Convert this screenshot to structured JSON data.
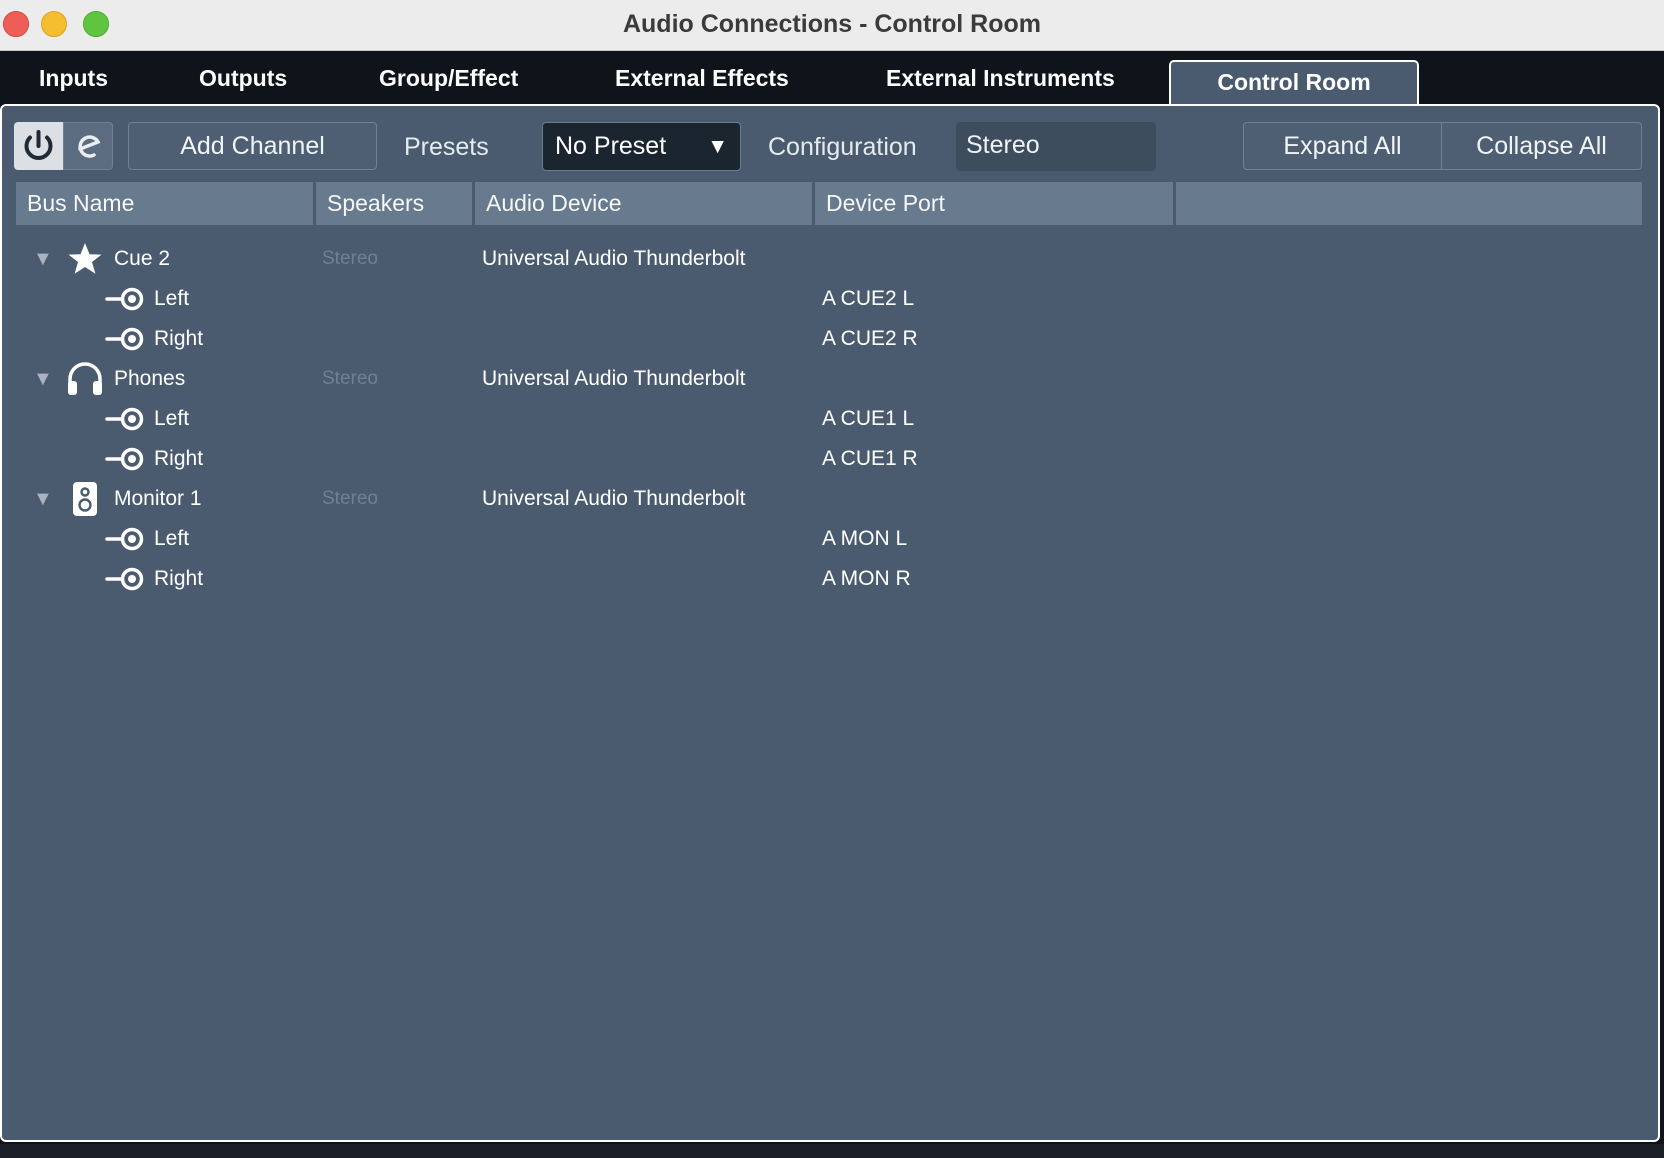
{
  "window": {
    "title": "Audio Connections - Control Room"
  },
  "tabs": [
    {
      "label": "Inputs",
      "active": false
    },
    {
      "label": "Outputs",
      "active": false
    },
    {
      "label": "Group/Effect",
      "active": false
    },
    {
      "label": "External Effects",
      "active": false
    },
    {
      "label": "External Instruments",
      "active": false
    },
    {
      "label": "Control Room",
      "active": true
    }
  ],
  "toolbar": {
    "power_icon": "power-icon",
    "e_icon": "edit-e-icon",
    "add_channel_label": "Add Channel",
    "presets_label": "Presets",
    "preset_value": "No Preset",
    "configuration_label": "Configuration",
    "configuration_value": "Stereo",
    "expand_all_label": "Expand All",
    "collapse_all_label": "Collapse All"
  },
  "table": {
    "columns": [
      "Bus Name",
      "Speakers",
      "Audio Device",
      "Device Port",
      ""
    ],
    "buses": [
      {
        "name": "Cue 2",
        "icon": "star-icon",
        "speakers": "Stereo",
        "device": "Universal Audio Thunderbolt",
        "expanded": true,
        "ports": [
          {
            "name": "Left",
            "port": "A CUE2 L"
          },
          {
            "name": "Right",
            "port": "A CUE2 R"
          }
        ]
      },
      {
        "name": "Phones",
        "icon": "headphones-icon",
        "speakers": "Stereo",
        "device": "Universal Audio Thunderbolt",
        "expanded": true,
        "ports": [
          {
            "name": "Left",
            "port": "A CUE1 L"
          },
          {
            "name": "Right",
            "port": "A CUE1 R"
          }
        ]
      },
      {
        "name": "Monitor 1",
        "icon": "speaker-icon",
        "speakers": "Stereo",
        "device": "Universal Audio Thunderbolt",
        "expanded": true,
        "ports": [
          {
            "name": "Left",
            "port": "A MON L"
          },
          {
            "name": "Right",
            "port": "A MON R"
          }
        ]
      }
    ]
  },
  "colors": {
    "panel_bg": "#4a5b6f",
    "header_bg": "#687a8e",
    "window_bg": "#0f141b"
  }
}
